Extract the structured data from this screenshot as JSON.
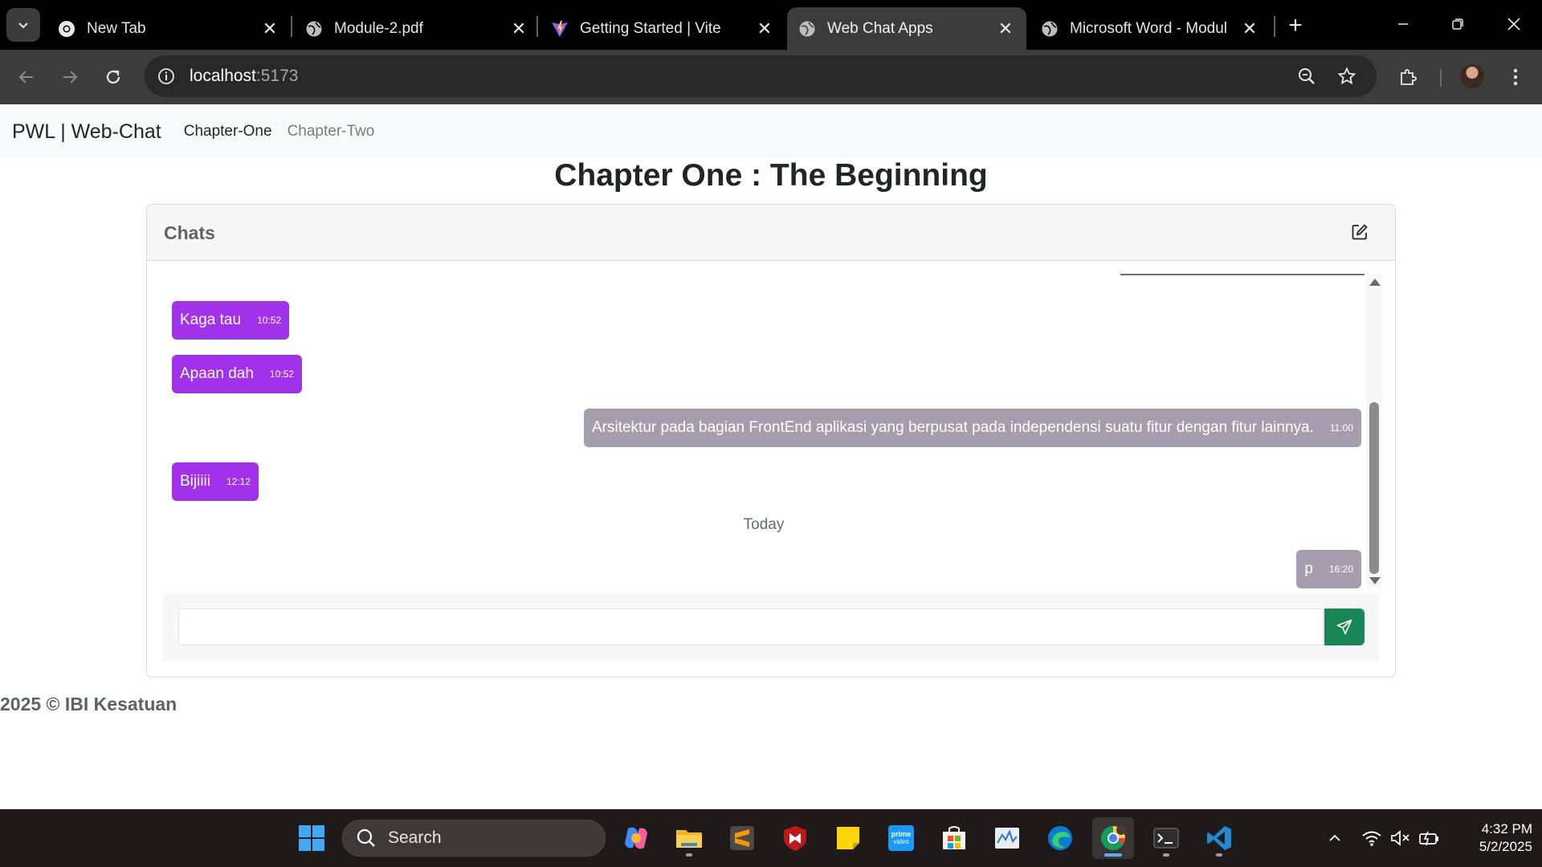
{
  "browser": {
    "tabs": [
      {
        "title": "New Tab",
        "icon": "chrome-icon"
      },
      {
        "title": "Module-2.pdf",
        "icon": "globe-icon"
      },
      {
        "title": "Getting Started | Vite",
        "icon": "vite-icon"
      },
      {
        "title": "Web Chat Apps",
        "icon": "globe-icon",
        "active": true
      },
      {
        "title": "Microsoft Word - Modul",
        "icon": "globe-icon"
      }
    ],
    "url_host": "localhost",
    "url_port": ":5173"
  },
  "navbar": {
    "brand": "PWL | Web-Chat",
    "links": [
      "Chapter-One",
      "Chapter-Two"
    ],
    "active_link": "Chapter-One"
  },
  "page": {
    "title": "Chapter One : The Beginning"
  },
  "chat": {
    "header": "Chats",
    "messages": [
      {
        "text": "Kaga tau",
        "time": "10:52",
        "side": "incoming"
      },
      {
        "text": "Apaan dah",
        "time": "10:52",
        "side": "incoming"
      },
      {
        "text": "Arsitektur pada bagian FrontEnd aplikasi yang berpusat pada independensi suatu fitur dengan fitur lainnya.",
        "time": "11:00",
        "side": "outgoing"
      },
      {
        "text": "Bijiiii",
        "time": "12:12",
        "side": "incoming"
      },
      {
        "text": "p",
        "time": "16:20",
        "side": "outgoing"
      }
    ],
    "day_separator": "Today",
    "input_value": "",
    "colors": {
      "incoming": "#a231eb",
      "outgoing": "#a59cae",
      "send": "#198754"
    }
  },
  "footer": {
    "text": "2025 © IBI Kesatuan"
  },
  "taskbar": {
    "search_label": "Search",
    "apps": [
      "windows-start-icon",
      "copilot-icon",
      "file-explorer-icon",
      "sublime-text-icon",
      "mcafee-icon",
      "sticky-notes-icon",
      "prime-video-icon",
      "microsoft-store-icon",
      "task-manager-icon",
      "edge-icon",
      "chrome-icon",
      "terminal-icon",
      "vscode-icon"
    ],
    "time": "4:32 PM",
    "date": "5/2/2025"
  }
}
